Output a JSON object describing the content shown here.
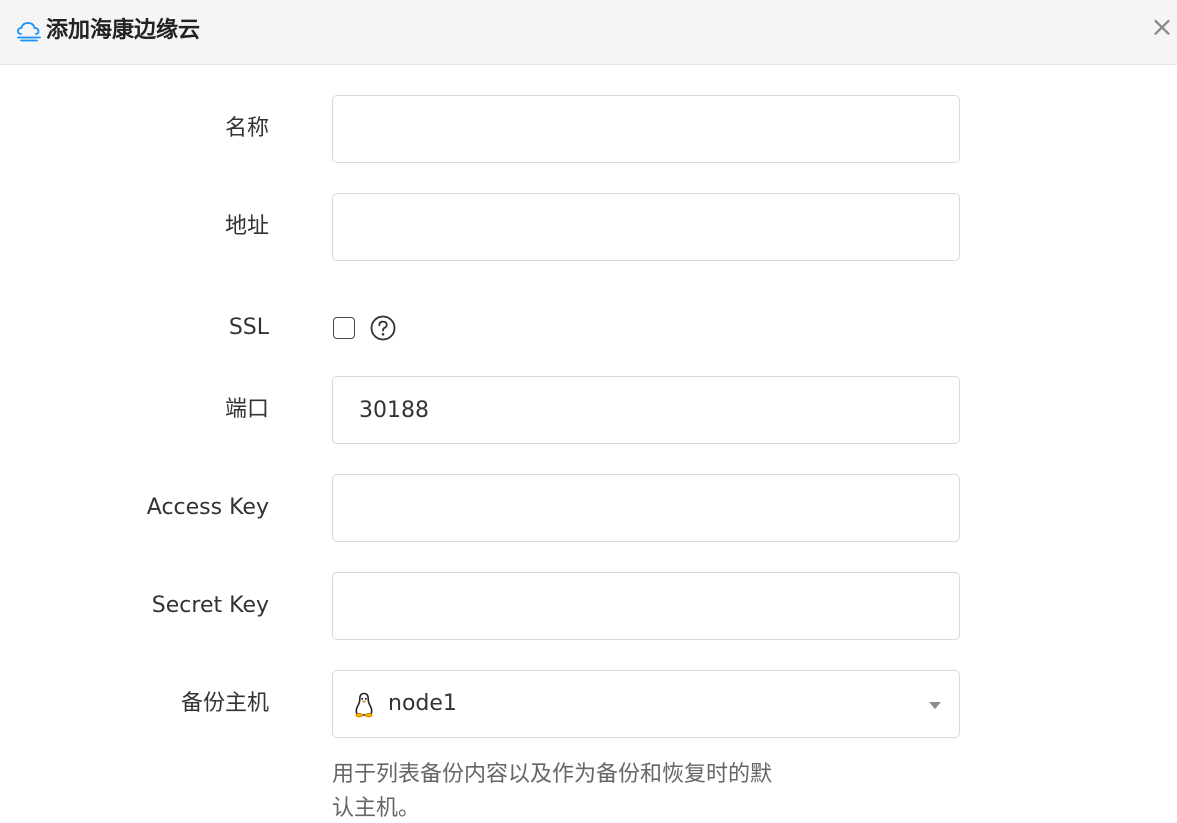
{
  "dialog": {
    "title": "添加海康边缘云",
    "icon": "cloud-icon",
    "close_label": "×"
  },
  "form": {
    "name": {
      "label": "名称",
      "value": "",
      "placeholder": ""
    },
    "address": {
      "label": "地址",
      "value": "",
      "placeholder": ""
    },
    "ssl": {
      "label": "SSL",
      "checked": false,
      "help_icon": "question-circle-icon"
    },
    "port": {
      "label": "端口",
      "value": "30188"
    },
    "access_key": {
      "label": "Access Key",
      "value": "",
      "placeholder": ""
    },
    "secret_key": {
      "label": "Secret Key",
      "value": "",
      "placeholder": ""
    },
    "backup_host": {
      "label": "备份主机",
      "selected": "node1",
      "selected_icon": "linux-icon",
      "help": "用于列表备份内容以及作为备份和恢复时的默认主机。"
    }
  },
  "colors": {
    "accent": "#1890ff",
    "header_bg": "#f5f5f5",
    "border": "#d9d9d9"
  }
}
